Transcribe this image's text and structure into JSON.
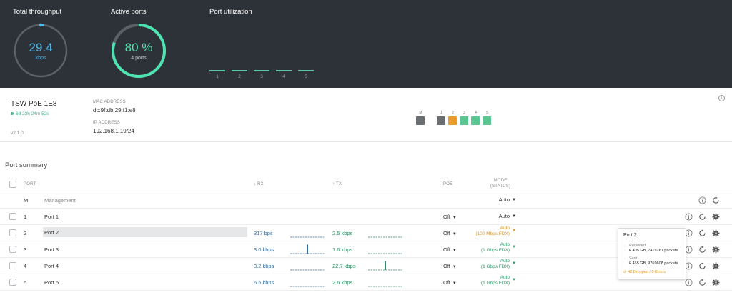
{
  "top": {
    "throughput": {
      "title": "Total throughput",
      "value": "29.4",
      "unit": "kbps",
      "fraction": 0.02
    },
    "active_ports": {
      "title": "Active ports",
      "value": "80 %",
      "sub": "4 ports",
      "fraction": 0.8
    },
    "utilization": {
      "title": "Port utilization",
      "ports": [
        "1",
        "2",
        "3",
        "4",
        "5"
      ]
    }
  },
  "device": {
    "name": "TSW PoE 1E8",
    "uptime": "6d 23h 24m 52s",
    "version": "v2.1.0",
    "mac_label": "MAC ADDRESS",
    "mac": "dc:9f:db:29:f1:e8",
    "ip_label": "IP ADDRESS",
    "ip": "192.168.1.19/24",
    "info_glyph": "i",
    "port_map": [
      {
        "label": "M",
        "color": "#6b6e71"
      },
      {
        "label": "1",
        "color": "#6b6e71"
      },
      {
        "label": "2",
        "color": "#e79c2e"
      },
      {
        "label": "3",
        "color": "#5bc691"
      },
      {
        "label": "4",
        "color": "#5bc691"
      },
      {
        "label": "5",
        "color": "#5bc691"
      }
    ]
  },
  "port_summary": {
    "title": "Port summary",
    "headers": {
      "port": "PORT",
      "rx": "↓ RX",
      "tx": "↑ TX",
      "poe": "POE",
      "mode": "MODE",
      "mode_sub": "(STATUS)"
    },
    "rows": [
      {
        "num": "M",
        "name": "Management",
        "rx": "",
        "tx": "",
        "poe": "",
        "mode": "Auto",
        "status": "",
        "rx_spike": 0,
        "tx_spike": 0
      },
      {
        "num": "1",
        "name": "Port 1",
        "rx": "",
        "tx": "",
        "poe": "Off",
        "mode": "Auto",
        "status": "",
        "rx_spike": 0,
        "tx_spike": 0
      },
      {
        "num": "2",
        "name": "Port 2",
        "rx": "317 bps",
        "tx": "2.5 kbps",
        "poe": "Off",
        "mode": "Auto",
        "status": "(100 Mbps FDX)",
        "rx_spike": 0,
        "tx_spike": 0
      },
      {
        "num": "3",
        "name": "Port 3",
        "rx": "3.0 kbps",
        "tx": "1.6 kbps",
        "poe": "Off",
        "mode": "Auto",
        "status": "(1 Gbps FDX)",
        "rx_spike": 0.9,
        "tx_spike": 0
      },
      {
        "num": "4",
        "name": "Port 4",
        "rx": "3.2 kbps",
        "tx": "22.7 kbps",
        "poe": "Off",
        "mode": "Auto",
        "status": "(1 Gbps FDX)",
        "rx_spike": 0,
        "tx_spike": 0.9
      },
      {
        "num": "5",
        "name": "Port 5",
        "rx": "6.5 kbps",
        "tx": "2.6 kbps",
        "poe": "Off",
        "mode": "Auto",
        "status": "(1 Gbps FDX)",
        "rx_spike": 0,
        "tx_spike": 0
      }
    ]
  },
  "popover": {
    "title": "Port 2",
    "received_label": "Received",
    "received": "6.405 GB, 7419261 packets",
    "sent_label": "Sent",
    "sent": "6.455 GB, 9769608 packets",
    "errors": "42 Dropped / 0 Errors"
  },
  "colors": {
    "accent_green": "#44b58e",
    "orange": "#e09a2b",
    "rx_blue": "#3a6e9e",
    "tx_green": "#2e8a62",
    "dark_bg": "#2d3238",
    "throughput_ring": "#4fb8e8",
    "ports_ring": "#4ee3b0"
  },
  "icons": {
    "info": "info-icon",
    "restart": "restart-icon",
    "settings": "gear-icon"
  }
}
